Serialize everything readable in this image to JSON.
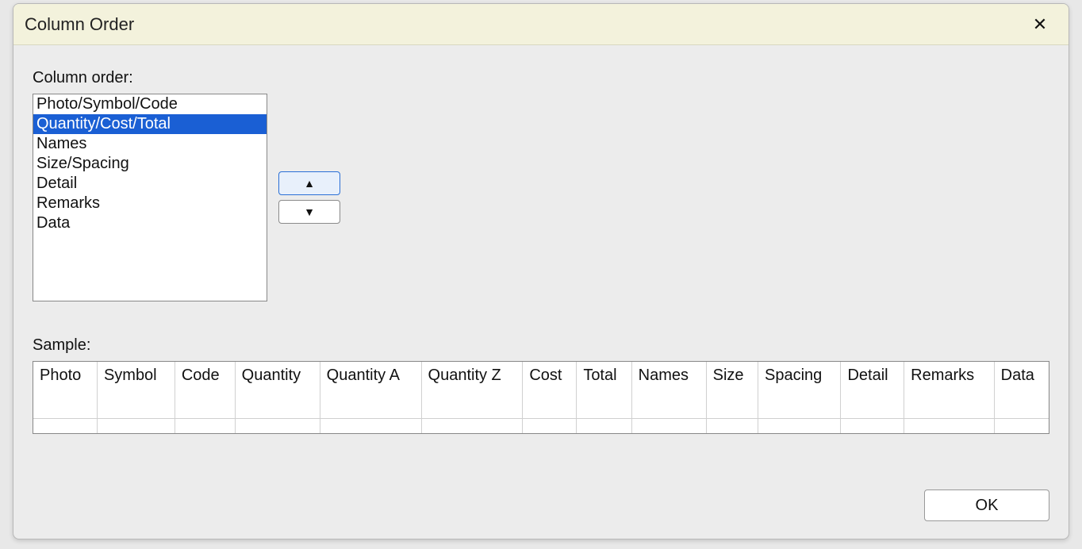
{
  "dialog": {
    "title": "Column Order",
    "close_glyph": "✕"
  },
  "labels": {
    "column_order": "Column order:",
    "sample": "Sample:"
  },
  "list": {
    "selected_index": 1,
    "items": [
      "Photo/Symbol/Code",
      "Quantity/Cost/Total",
      "Names",
      "Size/Spacing",
      "Detail",
      "Remarks",
      "Data"
    ]
  },
  "arrows": {
    "up_glyph": "▲",
    "down_glyph": "▼"
  },
  "sample": {
    "headers": [
      "Photo",
      "Symbol",
      "Code",
      "Quantity",
      "Quantity A",
      "Quantity Z",
      "Cost",
      "Total",
      "Names",
      "Size",
      "Spacing",
      "Detail",
      "Remarks",
      "Data"
    ]
  },
  "buttons": {
    "ok": "OK"
  }
}
